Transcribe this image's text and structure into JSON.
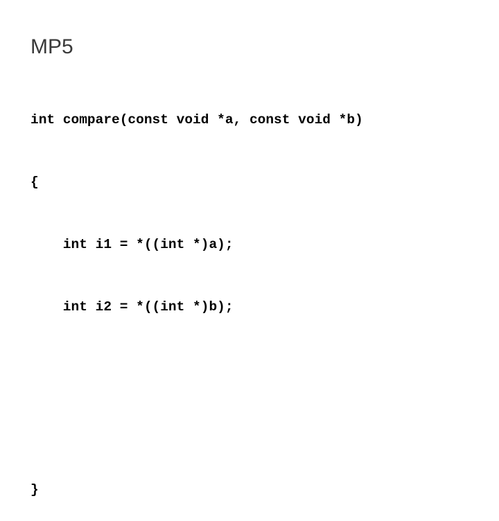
{
  "slide": {
    "title": "MP5",
    "code_lines": [
      "int compare(const void *a, const void *b)",
      "{",
      "    int i1 = *((int *)a);",
      "    int i2 = *((int *)b);",
      "",
      "",
      "}"
    ]
  }
}
